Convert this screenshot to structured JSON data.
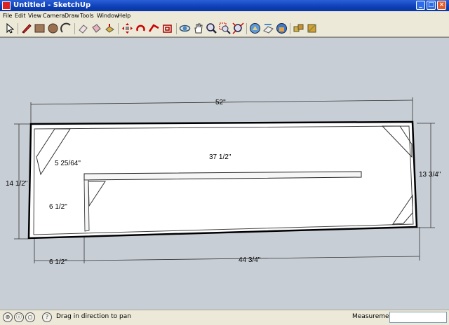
{
  "window": {
    "title": "Untitled - SketchUp"
  },
  "menu": {
    "items": [
      "File",
      "Edit",
      "View",
      "Camera",
      "Draw",
      "Tools",
      "Window",
      "Help"
    ]
  },
  "toolbar": {
    "tools": [
      "select-icon",
      "pencil-icon",
      "rectangle-icon",
      "circle-icon",
      "arc-icon",
      "eraser-icon",
      "paint-bucket-icon",
      "push-pull-icon",
      "move-icon",
      "rotate-icon",
      "follow-me-icon",
      "orbit-icon",
      "pan-icon",
      "zoom-icon",
      "zoom-extents-icon",
      "iso-view-icon",
      "top-view-icon",
      "front-view-icon",
      "components-icon",
      "materials-icon"
    ]
  },
  "dimensions": {
    "overall_width": "52\"",
    "inner_width": "37 1/2\"",
    "diagonal": "5 25/64\"",
    "left_height": "14 1/2\"",
    "right_height": "13 3/4\"",
    "shelf_height": "6 1/2\"",
    "bottom_left": "6 1/2\"",
    "bottom_right": "44 3/4\""
  },
  "status": {
    "hint": "Drag in direction to pan",
    "measurements_label": "Measurements",
    "measurements_value": ""
  },
  "colors": {
    "titlebar": "#0d3fb6",
    "viewport": "#c7ced5"
  }
}
